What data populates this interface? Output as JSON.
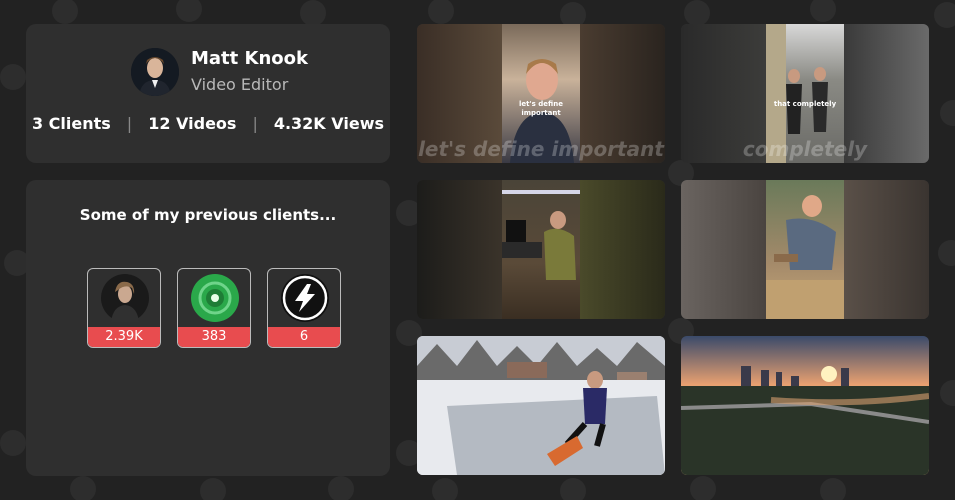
{
  "profile": {
    "name": "Matt Knook",
    "role": "Video Editor",
    "stats": {
      "clients": "3 Clients",
      "videos": "12 Videos",
      "views": "4.32K Views",
      "separator": "|"
    }
  },
  "clients_section": {
    "title": "Some of my previous clients...",
    "clients": [
      {
        "count": "2.39K",
        "icon": "person-avatar-icon"
      },
      {
        "count": "383",
        "icon": "green-leaf-logo-icon"
      },
      {
        "count": "6",
        "icon": "bolt-logo-icon"
      }
    ]
  },
  "videos": [
    {
      "caption": "let's define important",
      "overlay": "let's define important",
      "icon": "video-thumbnail"
    },
    {
      "caption": "that completely",
      "overlay": "completely",
      "icon": "video-thumbnail"
    },
    {
      "caption": "",
      "overlay": "",
      "icon": "video-thumbnail"
    },
    {
      "caption": "",
      "overlay": "",
      "icon": "video-thumbnail"
    },
    {
      "caption": "",
      "overlay": "",
      "icon": "video-thumbnail"
    },
    {
      "caption": "",
      "overlay": "",
      "icon": "video-thumbnail"
    }
  ],
  "colors": {
    "background": "#222222",
    "card": "#2f2f2f",
    "accent_red": "#e84c4f",
    "muted_text": "#b8b8b8"
  }
}
